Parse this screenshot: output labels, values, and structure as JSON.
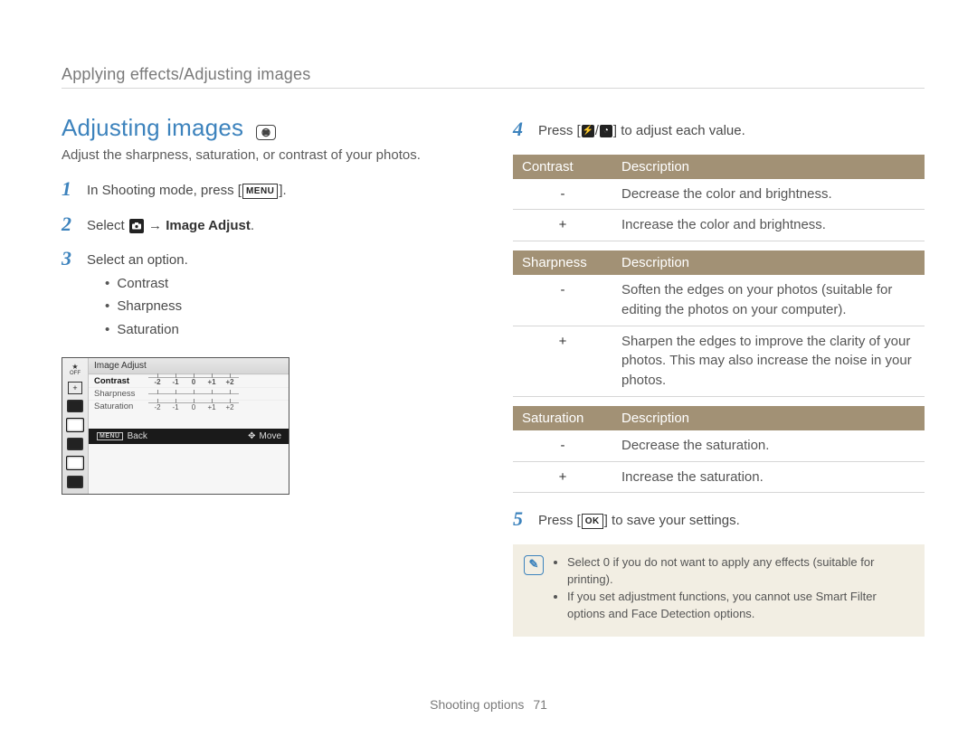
{
  "breadcrumb": "Applying effects/Adjusting images",
  "title": "Adjusting images",
  "mode_badge": "p",
  "subtitle": "Adjust the sharpness, saturation, or contrast of your photos.",
  "steps": {
    "s1_pre": "In Shooting mode, press [",
    "s1_btn": "MENU",
    "s1_post": "].",
    "s2_pre": "Select ",
    "s2_arrow": " → ",
    "s2_bold": "Image Adjust",
    "s2_post": ".",
    "s3": "Select an option.",
    "s3_items": [
      "Contrast",
      "Sharpness",
      "Saturation"
    ],
    "s4_pre": "Press [",
    "s4_mid": "/",
    "s4_post": "] to adjust each value.",
    "s5_pre": "Press [",
    "s5_btn": "OK",
    "s5_post": "] to save your settings."
  },
  "lcd": {
    "header": "Image Adjust",
    "rows": [
      {
        "name": "Contrast",
        "scale": [
          "-2",
          "-1",
          "0",
          "+1",
          "+2"
        ],
        "sel": true
      },
      {
        "name": "Sharpness",
        "scale": [
          "",
          "",
          "",
          "",
          ""
        ]
      },
      {
        "name": "Saturation",
        "scale": [
          "-2",
          "-1",
          "0",
          "+1",
          "+2"
        ]
      }
    ],
    "footer_left": "Back",
    "footer_lefticon": "MENU",
    "footer_right": "Move"
  },
  "tables": {
    "contrast": {
      "h1": "Contrast",
      "h2": "Description",
      "rows": [
        {
          "sym": "-",
          "desc": "Decrease the color and brightness."
        },
        {
          "sym": "+",
          "desc": "Increase the color and brightness."
        }
      ]
    },
    "sharpness": {
      "h1": "Sharpness",
      "h2": "Description",
      "rows": [
        {
          "sym": "-",
          "desc": "Soften the edges on your photos (suitable for editing the photos on your computer)."
        },
        {
          "sym": "+",
          "desc": "Sharpen the edges to improve the clarity of your photos. This may also increase the noise in your photos."
        }
      ]
    },
    "saturation": {
      "h1": "Saturation",
      "h2": "Description",
      "rows": [
        {
          "sym": "-",
          "desc": "Decrease the saturation."
        },
        {
          "sym": "+",
          "desc": "Increase the saturation."
        }
      ]
    }
  },
  "notes": [
    "Select 0 if you do not want to apply any effects (suitable for printing).",
    "If you set adjustment functions, you cannot use Smart Filter options and Face Detection options."
  ],
  "footer_section": "Shooting options",
  "footer_page": "71"
}
